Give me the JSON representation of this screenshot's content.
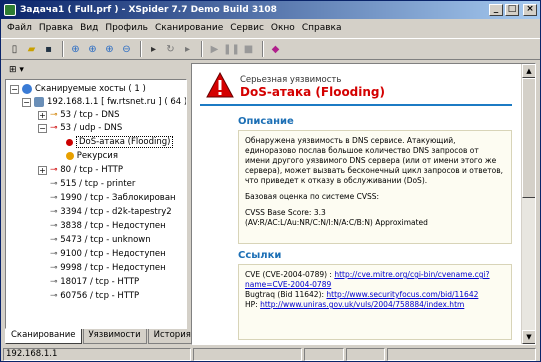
{
  "window": {
    "title": "Задача1 ( Full.prf ) - XSpider 7.7 Demo Build 3108"
  },
  "menu": [
    "Файл",
    "Правка",
    "Вид",
    "Профиль",
    "Сканирование",
    "Сервис",
    "Окно",
    "Справка"
  ],
  "left": {
    "toolbar_label": "⊞ ▾",
    "tree": [
      {
        "label": "Сканируемые хосты ( 1 )"
      },
      {
        "label": "192.168.1.1 [ fw.rtsnet.ru ] ( 64 )"
      },
      {
        "label": "53 / tcp - DNS"
      },
      {
        "label": "53 / udp - DNS"
      },
      {
        "label": "DoS-атака (Flooding)"
      },
      {
        "label": "Рекурсия"
      },
      {
        "label": "80 / tcp - HTTP"
      },
      {
        "label": "515 / tcp - printer"
      },
      {
        "label": "1990 / tcp - Заблокирован"
      },
      {
        "label": "3394 / tcp - d2k-tapestry2"
      },
      {
        "label": "3838 / tcp - Недоступен"
      },
      {
        "label": "5473 / tcp - unknown"
      },
      {
        "label": "9100 / tcp - Недоступен"
      },
      {
        "label": "9998 / tcp - Недоступен"
      },
      {
        "label": "18017 / tcp - HTTP"
      },
      {
        "label": "60756 / tcp - HTTP"
      }
    ]
  },
  "tabs": [
    "Сканирование",
    "Уязвимости",
    "История сканирований"
  ],
  "detail": {
    "severity": "Серьезная уязвимость",
    "title": "DoS-атака (Flooding)",
    "desc_heading": "Описание",
    "desc_text": "Обнаружена уязвимость в DNS сервисе. Атакующий, единоразово послав большое количество DNS запросов от имени другого уязвимого DNS сервера (или от имени этого же сервера), может вызвать бесконечный цикл запросов и ответов, что приведет к отказу в обслуживании (DoS).",
    "cvss_label": "Базовая оценка по системе CVSS:",
    "cvss_score": "CVSS Base Score: 3.3",
    "cvss_vector": "(AV:R/AC:L/Au:NR/C:N/I:N/A:C/B:N) Approximated",
    "links_heading": "Ссылки",
    "cve_prefix": "CVE (CVE-2004-0789) : ",
    "cve_link": "http://cve.mitre.org/cgi-bin/cvename.cgi?name=CVE-2004-0789",
    "bugtraq_prefix": "Bugtraq (Bid 11642): ",
    "bugtraq_link": "http://www.securityfocus.com/bid/11642",
    "uniras_prefix": "НР: ",
    "uniras_link": "http://www.uniras.gov.uk/vuls/2004/758884/index.htm"
  },
  "status": {
    "host": "192.168.1.1"
  }
}
